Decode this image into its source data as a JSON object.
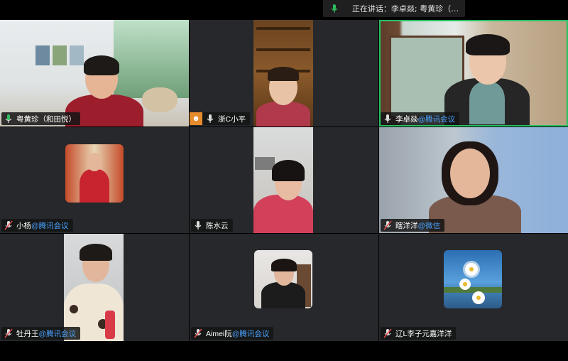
{
  "speaking": {
    "label": "正在讲话：李卓燚; 粤黄珍（和..."
  },
  "participants": [
    {
      "name": "粤黄珍（和田悦）",
      "org": "",
      "mic": "on"
    },
    {
      "name": "浙C小平",
      "org": "",
      "mic": "on"
    },
    {
      "name": "李卓燚",
      "org": "@腾讯会议",
      "mic": "on"
    },
    {
      "name": "小杨",
      "org": "@腾讯会议",
      "mic": "muted"
    },
    {
      "name": "陈水云",
      "org": "",
      "mic": "on"
    },
    {
      "name": "瞎洋洋",
      "org": "@微信",
      "mic": "muted"
    },
    {
      "name": "牡丹王",
      "org": "@腾讯会议",
      "mic": "muted"
    },
    {
      "name": "Aimei阮",
      "org": "@腾讯会议",
      "mic": "muted"
    },
    {
      "name": "辽L李子元嘉洋洋",
      "org": "",
      "mic": "muted"
    }
  ],
  "colors": {
    "active_border": "#27c262",
    "mic_on": "#2fbf5f",
    "mic_muted": "#e04b4b",
    "org_link": "#4aa3ff",
    "tile_bg": "#26282b"
  }
}
